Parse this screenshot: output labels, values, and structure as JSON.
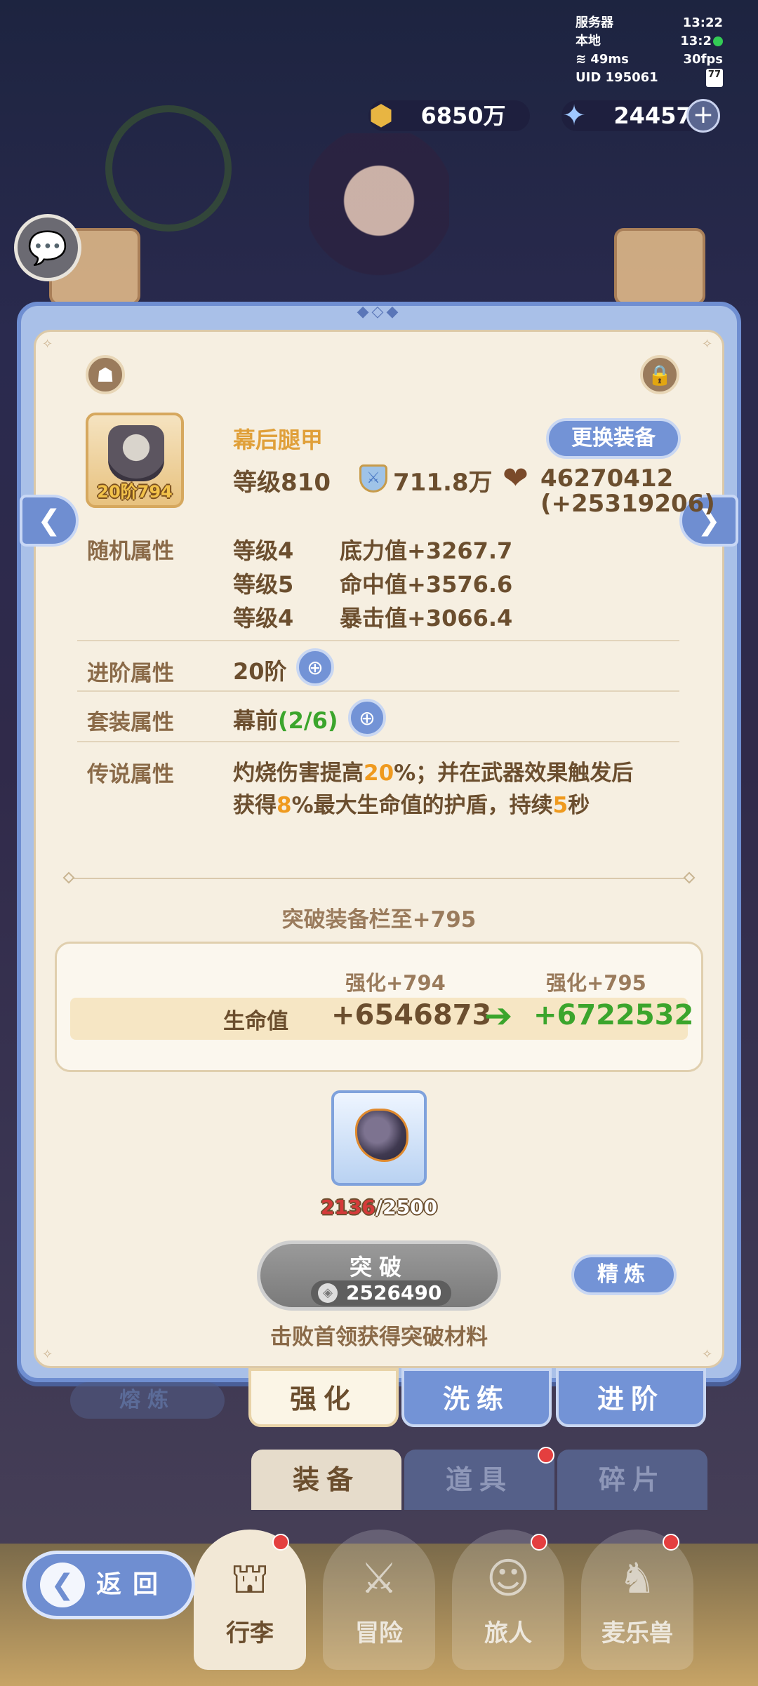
{
  "hud": {
    "server_label": "服务器",
    "server_time": "13:22",
    "local_label": "本地",
    "local_time": "13:2",
    "ping": "49ms",
    "fps": "30fps",
    "uid": "UID 195061",
    "battery": "77"
  },
  "currency": {
    "gold": "6850万",
    "gems": "24457",
    "plus": "+"
  },
  "equipment": {
    "name": "幕后腿甲",
    "stage_badge": "20阶794",
    "level": "等级810",
    "power": "711.8万",
    "hp": "46270412",
    "hp_bonus": "(+25319206)",
    "change_button": "更换装备"
  },
  "attributes": {
    "random_label": "随机属性",
    "random": [
      {
        "level": "等级4",
        "stat": "底力值+3267.7"
      },
      {
        "level": "等级5",
        "stat": "命中值+3576.6"
      },
      {
        "level": "等级4",
        "stat": "暴击值+3066.4"
      }
    ],
    "advance_label": "进阶属性",
    "advance_value": "20阶",
    "set_label": "套装属性",
    "set_name": "幕前",
    "set_progress": "(2/6)",
    "legend_label": "传说属性",
    "legend_line1_a": "灼烧伤害提高",
    "legend_line1_b": "20",
    "legend_line1_c": "%；并在武器效果触发后",
    "legend_line2_a": "获得",
    "legend_line2_b": "8",
    "legend_line2_c": "%最大生命值的护盾，持续",
    "legend_line2_d": "5",
    "legend_line2_e": "秒"
  },
  "breakthrough": {
    "title": "突破装备栏至+795",
    "col_from": "强化+794",
    "col_to": "强化+795",
    "stat": "生命值",
    "from_value": "+6546873",
    "arrow": "➔",
    "to_value": "+6722532",
    "material_have": "2136",
    "material_need": "/2500",
    "break_button": "突破",
    "break_cost": "2526490",
    "refine_button": "精炼",
    "hint": "击败首领获得突破材料"
  },
  "subtabs": {
    "smelt": "熔炼",
    "strengthen": "强化",
    "wash": "洗练",
    "advance": "进阶"
  },
  "bag_tabs": {
    "equip": "装备",
    "items": "道具",
    "fragments": "碎片"
  },
  "bottom_nav": {
    "back": "返回",
    "bag": "行李",
    "adventure": "冒险",
    "traveler": "旅人",
    "pet": "麦乐兽"
  },
  "colors": {
    "accent_blue": "#7393d6",
    "panel_bg": "#f6efe1",
    "text_brown": "#6b4e2e",
    "green": "#3ba52c",
    "orange": "#ef9a1f",
    "red": "#d53a3a"
  }
}
